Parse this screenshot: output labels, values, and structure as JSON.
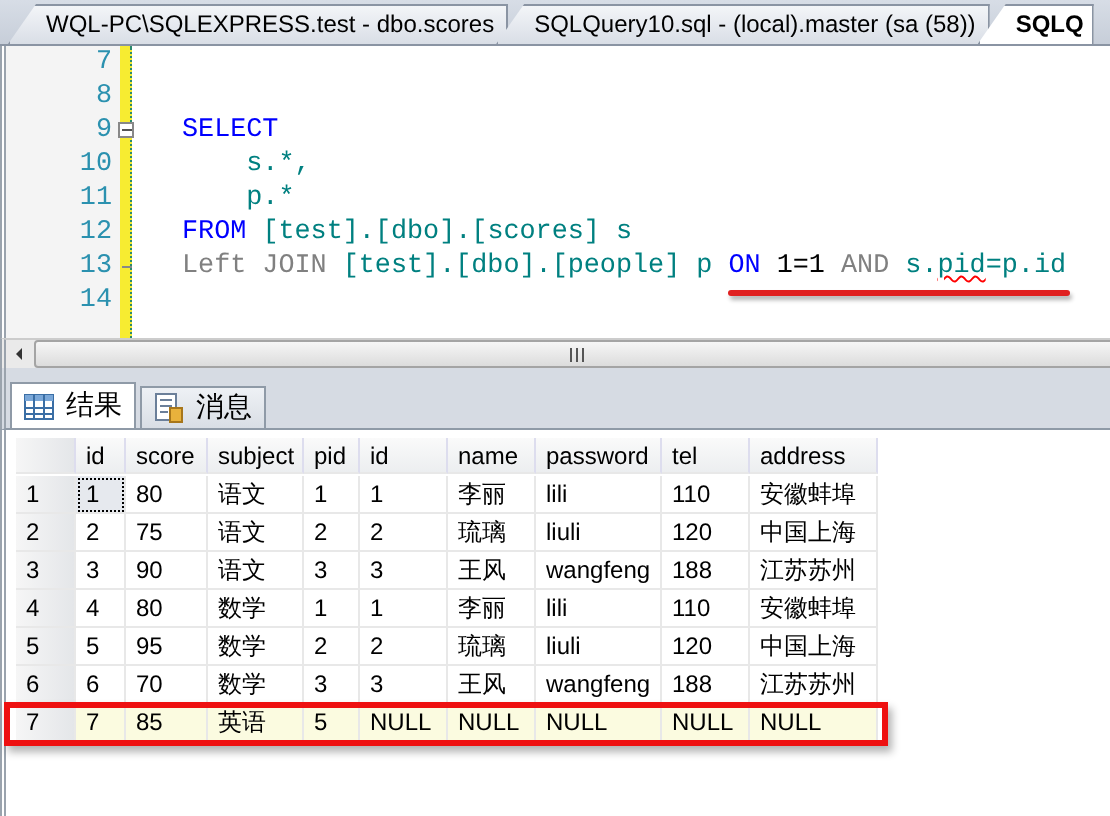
{
  "document_tabs": [
    {
      "label": "WQL-PC\\SQLEXPRESS.test - dbo.scores",
      "selected": false
    },
    {
      "label": "SQLQuery10.sql - (local).master (sa (58))",
      "selected": false
    },
    {
      "label": "SQLQ",
      "selected": true
    }
  ],
  "editor": {
    "lines": [
      {
        "number": "7",
        "fold_start": false,
        "fold_end": false
      },
      {
        "number": "8",
        "fold_start": false,
        "fold_end": false
      },
      {
        "number": "9",
        "fold_start": true,
        "fold_end": false,
        "tokens": [
          {
            "text": "SELECT",
            "kind": "keyword",
            "squiggle": false
          }
        ]
      },
      {
        "number": "10",
        "fold_start": false,
        "fold_end": false,
        "tokens": [
          {
            "text": "    s.*,",
            "kind": "ident",
            "squiggle": false
          }
        ]
      },
      {
        "number": "11",
        "fold_start": false,
        "fold_end": false,
        "tokens": [
          {
            "text": "    p.*",
            "kind": "ident",
            "squiggle": false
          }
        ]
      },
      {
        "number": "12",
        "fold_start": false,
        "fold_end": false,
        "tokens": [
          {
            "text": "FROM",
            "kind": "keyword",
            "squiggle": false
          },
          {
            "text": " [test].[dbo].[scores] s",
            "kind": "ident",
            "squiggle": false
          }
        ]
      },
      {
        "number": "13",
        "fold_start": false,
        "fold_end": true,
        "tokens": [
          {
            "text": "Left JOIN",
            "kind": "operator",
            "squiggle": false
          },
          {
            "text": " [test].[dbo].[people] p ",
            "kind": "ident",
            "squiggle": false
          }
        ],
        "underlined_tokens": [
          {
            "text": "ON",
            "kind": "keyword",
            "squiggle": false
          },
          {
            "text": " 1=1",
            "kind": "number",
            "squiggle": false
          },
          {
            "text": " AND",
            "kind": "operator",
            "squiggle": false
          },
          {
            "text": " s.",
            "kind": "ident",
            "squiggle": false
          },
          {
            "text": "pid",
            "kind": "ident",
            "squiggle": true
          },
          {
            "text": "=p.id",
            "kind": "ident",
            "squiggle": false
          }
        ]
      },
      {
        "number": "14",
        "fold_start": false,
        "fold_end": false
      }
    ]
  },
  "result_tabs": [
    {
      "label": "结果",
      "kind": "grid",
      "selected": true
    },
    {
      "label": "消息",
      "kind": "messages",
      "selected": false
    }
  ],
  "grid": {
    "columns": [
      "id",
      "score",
      "subject",
      "pid",
      "id",
      "name",
      "password",
      "tel",
      "address"
    ],
    "rows": [
      {
        "row_number": "1",
        "current": true,
        "highlighted": false,
        "cells": [
          "1",
          "80",
          "语文",
          "1",
          "1",
          "李丽",
          "lili",
          "110",
          "安徽蚌埠"
        ]
      },
      {
        "row_number": "2",
        "current": false,
        "highlighted": false,
        "cells": [
          "2",
          "75",
          "语文",
          "2",
          "2",
          "琉璃",
          "liuli",
          "120",
          "中国上海"
        ]
      },
      {
        "row_number": "3",
        "current": false,
        "highlighted": false,
        "cells": [
          "3",
          "90",
          "语文",
          "3",
          "3",
          "王风",
          "wangfeng",
          "188",
          "江苏苏州"
        ]
      },
      {
        "row_number": "4",
        "current": false,
        "highlighted": false,
        "cells": [
          "4",
          "80",
          "数学",
          "1",
          "1",
          "李丽",
          "lili",
          "110",
          "安徽蚌埠"
        ]
      },
      {
        "row_number": "5",
        "current": false,
        "highlighted": false,
        "cells": [
          "5",
          "95",
          "数学",
          "2",
          "2",
          "琉璃",
          "liuli",
          "120",
          "中国上海"
        ]
      },
      {
        "row_number": "6",
        "current": false,
        "highlighted": false,
        "cells": [
          "6",
          "70",
          "数学",
          "3",
          "3",
          "王风",
          "wangfeng",
          "188",
          "江苏苏州"
        ]
      },
      {
        "row_number": "7",
        "current": false,
        "highlighted": true,
        "cells": [
          "7",
          "85",
          "英语",
          "5",
          "NULL",
          "NULL",
          "NULL",
          "NULL",
          "NULL"
        ]
      }
    ]
  }
}
